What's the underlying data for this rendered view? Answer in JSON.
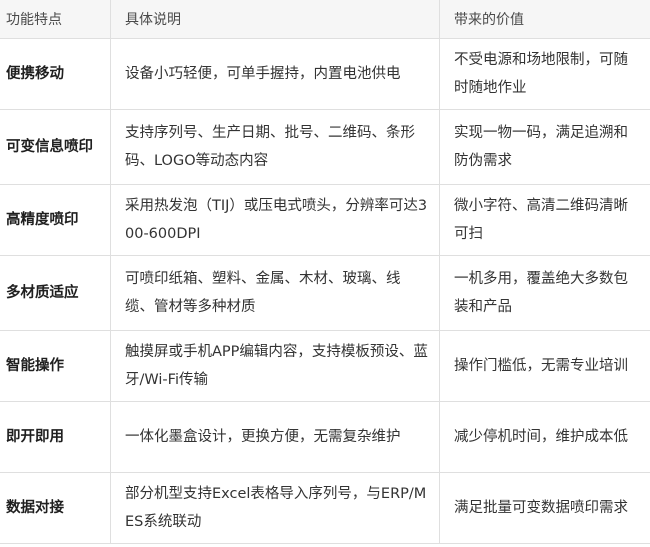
{
  "table": {
    "headers": [
      "功能特点",
      "具体说明",
      "带来的价值"
    ],
    "rows": [
      {
        "feature": "便携移动",
        "description": "设备小巧轻便，可单手握持，内置电池供电",
        "value": "不受电源和场地限制，可随时随地作业"
      },
      {
        "feature": "可变信息喷印",
        "description": "支持序列号、生产日期、批号、二维码、条形码、LOGO等动态内容",
        "value": "实现一物一码，满足追溯和防伪需求"
      },
      {
        "feature": "高精度喷印",
        "description": "采用热发泡（TIJ）或压电式喷头，分辨率可达300-600DPI",
        "value": "微小字符、高清二维码清晰可扫"
      },
      {
        "feature": "多材质适应",
        "description": "可喷印纸箱、塑料、金属、木材、玻璃、线缆、管材等多种材质",
        "value": "一机多用，覆盖绝大多数包装和产品"
      },
      {
        "feature": "智能操作",
        "description": "触摸屏或手机APP编辑内容，支持模板预设、蓝牙/Wi-Fi传输",
        "value": "操作门槛低，无需专业培训"
      },
      {
        "feature": "即开即用",
        "description": "一体化墨盒设计，更换方便，无需复杂维护",
        "value": "减少停机时间，维护成本低"
      },
      {
        "feature": "数据对接",
        "description": "部分机型支持Excel表格导入序列号，与ERP/MES系统联动",
        "value": "满足批量可变数据喷印需求"
      }
    ]
  }
}
